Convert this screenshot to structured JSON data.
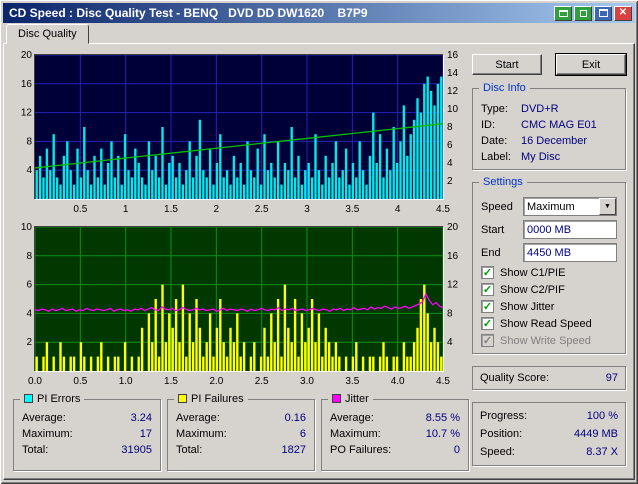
{
  "titlebar": {
    "title": "CD Speed : Disc Quality Test - BENQ   DVD DD DW1620    B7P9"
  },
  "glyphs": {
    "check": "✓",
    "dropdown": "▼",
    "close": "✕"
  },
  "tab": {
    "label": "Disc Quality"
  },
  "buttons": {
    "start": "Start",
    "exit": "Exit"
  },
  "disc_info": {
    "title": "Disc Info",
    "rows": [
      {
        "label": "Type:",
        "value": "DVD+R"
      },
      {
        "label": "ID:",
        "value": "CMC MAG E01"
      },
      {
        "label": "Date:",
        "value": "16 December"
      },
      {
        "label": "Label:",
        "value": "My Disc"
      }
    ]
  },
  "settings": {
    "title": "Settings",
    "speed_label": "Speed",
    "speed_value": "Maximum",
    "start_label": "Start",
    "start_value": "0000 MB",
    "end_label": "End",
    "end_value": "4450 MB",
    "checkboxes": [
      {
        "label": "Show C1/PIE",
        "checked": true,
        "enabled": true
      },
      {
        "label": "Show C2/PIF",
        "checked": true,
        "enabled": true
      },
      {
        "label": "Show Jitter",
        "checked": true,
        "enabled": true
      },
      {
        "label": "Show Read Speed",
        "checked": true,
        "enabled": true
      },
      {
        "label": "Show Write Speed",
        "checked": true,
        "enabled": false
      }
    ]
  },
  "quality": {
    "label": "Quality Score:",
    "value": "97"
  },
  "status": {
    "rows": [
      {
        "label": "Progress:",
        "value": "100 %"
      },
      {
        "label": "Position:",
        "value": "4449 MB"
      },
      {
        "label": "Speed:",
        "value": "8.37 X"
      }
    ]
  },
  "stats": [
    {
      "title": "PI Errors",
      "color": "#00ffff",
      "rows": [
        {
          "label": "Average:",
          "value": "3.24"
        },
        {
          "label": "Maximum:",
          "value": "17"
        },
        {
          "label": "Total:",
          "value": "31905"
        }
      ]
    },
    {
      "title": "PI Failures",
      "color": "#ffff00",
      "rows": [
        {
          "label": "Average:",
          "value": "0.16"
        },
        {
          "label": "Maximum:",
          "value": "6"
        },
        {
          "label": "Total:",
          "value": "1827"
        }
      ]
    },
    {
      "title": "Jitter",
      "color": "#ff00ff",
      "rows": [
        {
          "label": "Average:",
          "value": "8.55 %"
        },
        {
          "label": "Maximum:",
          "value": "10.7 %"
        },
        {
          "label": "PO Failures:",
          "value": "0"
        }
      ]
    }
  ],
  "chart_data": [
    {
      "svg": "chart-top",
      "type": "bar+line",
      "bg": "#000038",
      "grid": "#2424b4",
      "x_min": 0,
      "x_max": 4.5,
      "x_tick_values": [
        0.5,
        1,
        1.5,
        2,
        2.5,
        3,
        3.5,
        4,
        4.5
      ],
      "x_tick_labels": [
        "0.5",
        "1",
        "1.5",
        "2",
        "2.5",
        "3",
        "3.5",
        "4",
        "4.5"
      ],
      "left": {
        "min": 0,
        "max": 20,
        "ticks": [
          4,
          8,
          12,
          16,
          20
        ]
      },
      "right": {
        "min": 0,
        "max": 16,
        "ticks": [
          2,
          4,
          6,
          8,
          10,
          12,
          14,
          16
        ]
      },
      "bars": {
        "name": "PI Errors",
        "color": "#00eaea",
        "axis": "left",
        "values": [
          4,
          6,
          3,
          7,
          4,
          9,
          3,
          2,
          6,
          8,
          4,
          2,
          7,
          3,
          10,
          4,
          2,
          6,
          3,
          7,
          2,
          5,
          8,
          3,
          6,
          2,
          9,
          4,
          3,
          7,
          5,
          3,
          2,
          8,
          4,
          6,
          3,
          10,
          2,
          5,
          6,
          3,
          5,
          2,
          4,
          8,
          3,
          6,
          11,
          4,
          3,
          7,
          2,
          5,
          9,
          3,
          4,
          2,
          6,
          3,
          5,
          2,
          8,
          4,
          3,
          7,
          2,
          9,
          4,
          5,
          3,
          8,
          2,
          5,
          4,
          10,
          3,
          6,
          2,
          4,
          5,
          3,
          9,
          4,
          2,
          6,
          3,
          5,
          8,
          3,
          4,
          7,
          2,
          5,
          3,
          8,
          4,
          2,
          6,
          12,
          5,
          9,
          3,
          7,
          4,
          10,
          5,
          8,
          13,
          6,
          9,
          11,
          14,
          12,
          16,
          17,
          15,
          13,
          16,
          17
        ]
      },
      "line": {
        "name": "Read Speed",
        "color": "#00c000",
        "axis": "right",
        "values": [
          3.45,
          4.0,
          4.55,
          5.09,
          5.64,
          6.19,
          6.73,
          7.28,
          7.82,
          8.37
        ]
      }
    },
    {
      "svg": "chart-bottom",
      "type": "bar+line",
      "bg": "#003800",
      "grid": "#109010",
      "x_min": 0,
      "x_max": 4.5,
      "x_tick_values": [
        0,
        0.5,
        1,
        1.5,
        2,
        2.5,
        3,
        3.5,
        4,
        4.5
      ],
      "x_tick_labels": [
        "0.0",
        "0.5",
        "1.0",
        "1.5",
        "2.0",
        "2.5",
        "3.0",
        "3.5",
        "4.0",
        "4.5"
      ],
      "left": {
        "min": 0,
        "max": 10,
        "ticks": [
          2,
          4,
          6,
          8,
          10
        ]
      },
      "right": {
        "min": 0,
        "max": 20,
        "ticks": [
          4,
          8,
          12,
          16,
          20
        ]
      },
      "bars": {
        "name": "PI Failures",
        "color": "#ffff00",
        "axis": "left",
        "values": [
          1,
          0,
          1,
          2,
          0,
          1,
          0,
          2,
          1,
          0,
          1,
          1,
          0,
          2,
          1,
          0,
          1,
          0,
          1,
          2,
          0,
          1,
          0,
          1,
          1,
          0,
          2,
          0,
          1,
          0,
          1,
          3,
          0,
          4,
          2,
          5,
          1,
          6,
          2,
          4,
          3,
          5,
          2,
          6,
          1,
          4,
          2,
          5,
          3,
          1,
          2,
          4,
          1,
          3,
          5,
          2,
          1,
          3,
          2,
          4,
          1,
          2,
          0,
          1,
          2,
          0,
          1,
          3,
          1,
          4,
          2,
          5,
          1,
          6,
          3,
          2,
          5,
          1,
          4,
          2,
          3,
          5,
          2,
          4,
          1,
          3,
          2,
          1,
          2,
          1,
          0,
          1,
          0,
          1,
          2,
          0,
          1,
          0,
          1,
          1,
          0,
          1,
          2,
          1,
          0,
          1,
          1,
          0,
          2,
          1,
          1,
          2,
          3,
          5,
          6,
          4,
          2,
          3,
          2,
          1
        ]
      },
      "line": {
        "name": "Jitter",
        "color": "#ff00ff",
        "axis": "right",
        "values": [
          8.5,
          8.4,
          8.6,
          8.5,
          8.3,
          8.6,
          8.4,
          8.5,
          8.7,
          8.4,
          8.5,
          8.6,
          8.3,
          8.5,
          8.4,
          8.7,
          8.5,
          8.4,
          8.6,
          8.5,
          8.4,
          8.5,
          8.7,
          8.3,
          8.5,
          8.6,
          8.4,
          8.5,
          8.3,
          8.6,
          8.5,
          8.7,
          8.4,
          8.6,
          8.8,
          8.5,
          8.4,
          8.9,
          8.6,
          8.5,
          8.7,
          8.4,
          8.5,
          8.8,
          8.6,
          8.4,
          8.5,
          8.7,
          8.5,
          8.6,
          8.4,
          8.5,
          8.6,
          8.3,
          8.5,
          8.7,
          8.4,
          8.6,
          8.5,
          8.4,
          8.6,
          8.5,
          8.3,
          8.6,
          8.4,
          8.5,
          8.7,
          8.5,
          8.4,
          8.6,
          8.5,
          8.8,
          8.4,
          8.6,
          8.5,
          8.7,
          8.4,
          8.5,
          8.6,
          8.4,
          8.5,
          8.7,
          8.5,
          8.4,
          8.6,
          8.5,
          8.3,
          8.6,
          8.5,
          8.7,
          8.4,
          8.6,
          8.5,
          8.8,
          8.5,
          8.6,
          8.7,
          8.5,
          8.9,
          8.6,
          8.8,
          8.7,
          9.0,
          8.8,
          8.6,
          8.9,
          8.7,
          8.8,
          9.0,
          8.7,
          8.9,
          9.1,
          9.3,
          9.6,
          10.7,
          9.8,
          9.2,
          9.5,
          9.0,
          8.8
        ]
      }
    }
  ]
}
